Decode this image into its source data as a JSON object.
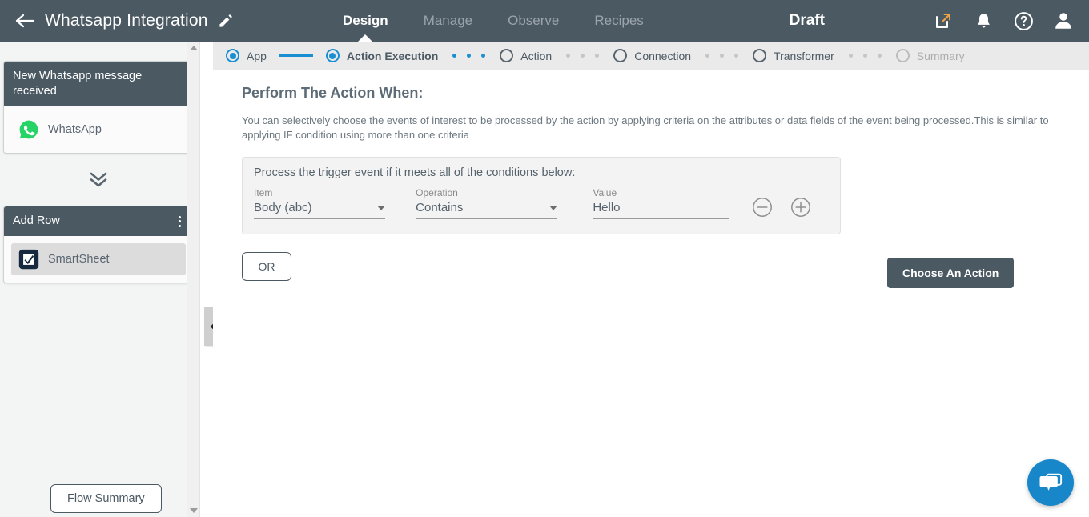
{
  "header": {
    "back_icon": "back-arrow-icon",
    "flow_title": "Whatsapp Integration",
    "edit_icon": "pencil-icon",
    "tabs": [
      {
        "label": "Design",
        "active": true
      },
      {
        "label": "Manage",
        "active": false
      },
      {
        "label": "Observe",
        "active": false
      },
      {
        "label": "Recipes",
        "active": false
      }
    ],
    "status": "Draft",
    "icons": [
      {
        "name": "open-external-icon"
      },
      {
        "name": "bell-icon"
      },
      {
        "name": "help-icon"
      },
      {
        "name": "user-avatar-icon"
      }
    ],
    "bg_color": "#4b5963"
  },
  "stepper": {
    "steps": [
      {
        "label": "App",
        "state": "done"
      },
      {
        "label": "Action Execution",
        "state": "current"
      },
      {
        "label": "Action",
        "state": "pending"
      },
      {
        "label": "Connection",
        "state": "pending"
      },
      {
        "label": "Transformer",
        "state": "pending"
      },
      {
        "label": "Summary",
        "state": "disabled"
      }
    ],
    "accent_color": "#1a8fd1"
  },
  "sidebar": {
    "trigger_card": {
      "title": "New Whatsapp message received",
      "app_label": "WhatsApp",
      "app_icon": "whatsapp-icon",
      "app_color": "#25d366"
    },
    "connector_icon": "double-chevron-down-icon",
    "action_card": {
      "title": "Add Row",
      "menu_icon": "kebab-menu-icon",
      "app_label": "SmartSheet",
      "app_icon": "smartsheet-icon",
      "app_color": "#16293f"
    },
    "flow_summary_label": "Flow Summary",
    "collapse_icon": "chevron-left-icon"
  },
  "main": {
    "section_title": "Perform The Action When:",
    "section_desc": "You can selectively choose the events of interest to be processed by the action by applying criteria on the attributes or data fields of the event being processed.This is similar to applying IF condition using more than one criteria",
    "condition_panel": {
      "heading": "Process the trigger event if it meets all of the conditions below:",
      "fields": {
        "item": {
          "label": "Item",
          "value": "Body (abc)"
        },
        "operation": {
          "label": "Operation",
          "value": "Contains"
        },
        "value": {
          "label": "Value",
          "value": "Hello",
          "placeholder": "Value"
        }
      },
      "remove_icon": "minus-circle-icon",
      "add_icon": "plus-circle-icon"
    },
    "or_label": "OR",
    "choose_action_label": "Choose An Action"
  },
  "chat": {
    "icon": "chat-bubble-icon",
    "color": "#1787c9"
  }
}
